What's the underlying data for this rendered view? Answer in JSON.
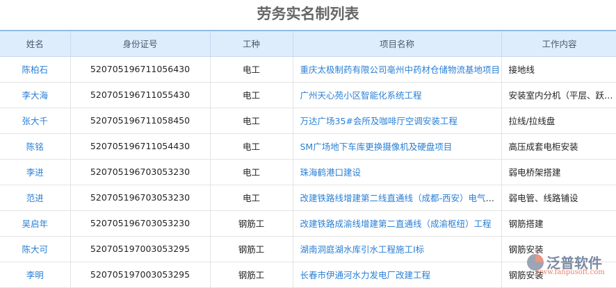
{
  "title": "劳务实名制列表",
  "columns": [
    "姓名",
    "身份证号",
    "工种",
    "项目名称",
    "工作内容"
  ],
  "rows": [
    [
      "陈柏石",
      "520705196711056430",
      "电工",
      "重庆太极制药有限公司亳州中药材仓储物流基地项目",
      "接地线"
    ],
    [
      "李大海",
      "520705196711055430",
      "电工",
      "广州天心苑小区智能化系统工程",
      "安装室内分机（平层、跃层）"
    ],
    [
      "张大千",
      "520705196711058450",
      "电工",
      "万达广场35#会所及咖啡厅空调安装工程",
      "拉线/拉线盘"
    ],
    [
      "陈铭",
      "520705196711054430",
      "电工",
      "SM广场地下车库更换摄像机及硬盘项目",
      "高压成套电柜安装"
    ],
    [
      "李进",
      "520705196703053230",
      "电工",
      "珠海鹤港口建设",
      "弱电桥架搭建"
    ],
    [
      "范进",
      "520705196703053230",
      "电工",
      "改建铁路线增建第二线直通线（成都-西安）电气工程",
      "弱电管、线路铺设"
    ],
    [
      "吴启年",
      "520705196703053230",
      "钢筋工",
      "改建铁路成渝线增建第二直通线（成渝枢纽）工程",
      "钢筋搭建"
    ],
    [
      "陈大可",
      "520705197003053295",
      "钢筋工",
      "湖南洞庭湖水库引水工程施工I标",
      "钢筋安装"
    ],
    [
      "李明",
      "520705197003053295",
      "钢筋工",
      "长春市伊通河水力发电厂改建工程",
      "钢筋安装"
    ]
  ],
  "logo": {
    "name": "泛普软件",
    "url": "www.fanpusoft.com"
  }
}
